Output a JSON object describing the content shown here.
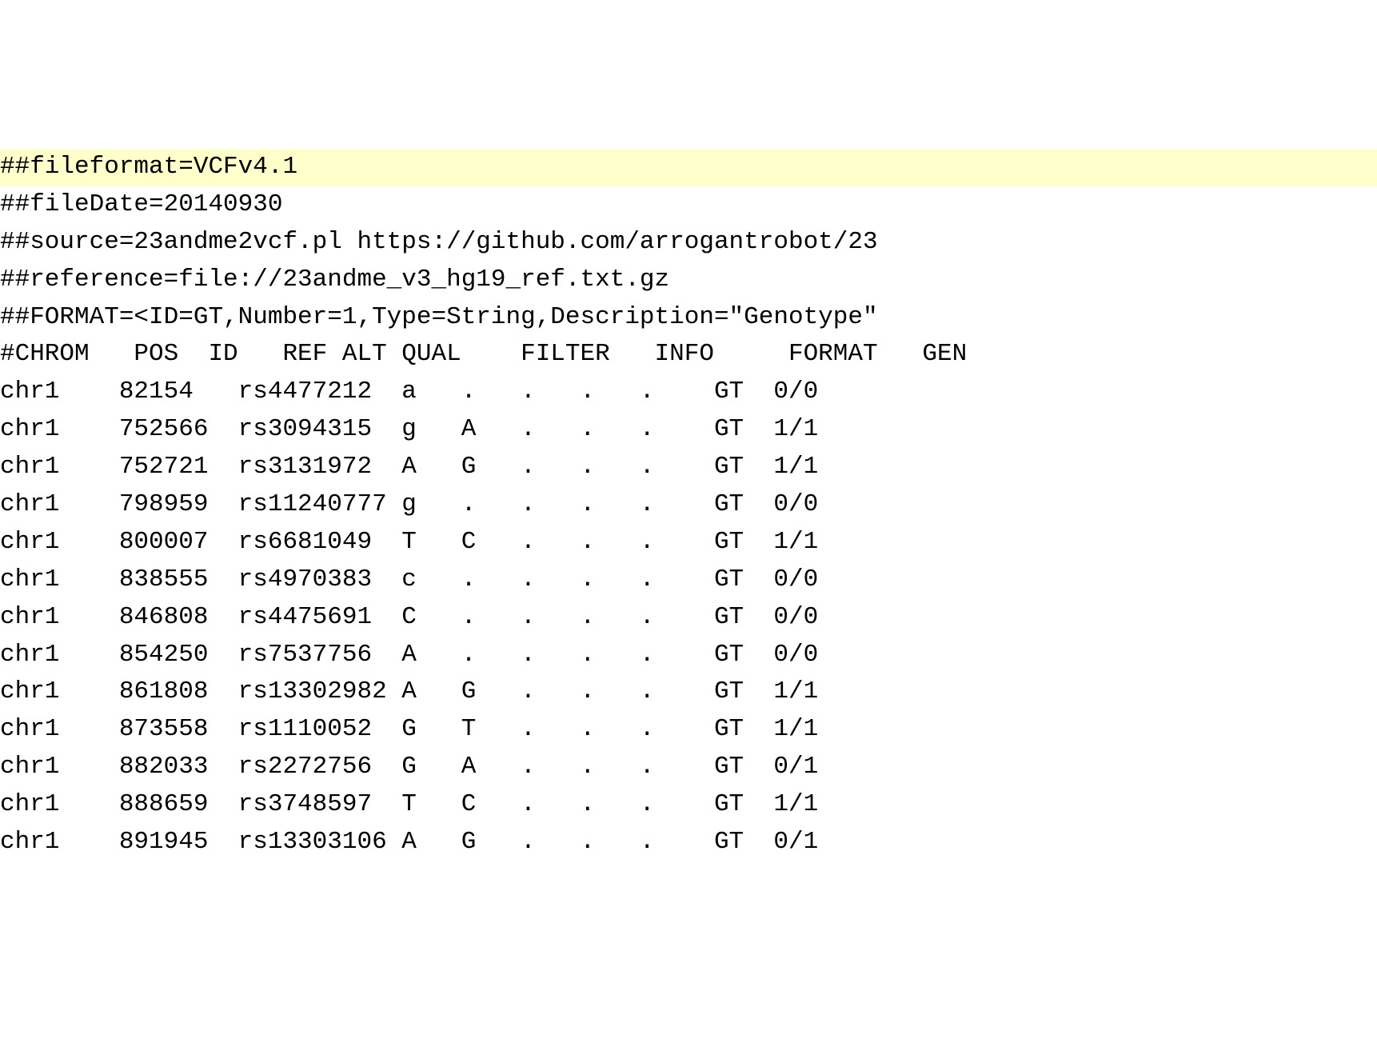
{
  "header": {
    "fileformat": "##fileformat=VCFv4.1",
    "fileDate": "##fileDate=20140930",
    "source": "##source=23andme2vcf.pl https://github.com/arrogantrobot/23",
    "reference": "##reference=file://23andme_v3_hg19_ref.txt.gz",
    "format": "##FORMAT=<ID=GT,Number=1,Type=String,Description=\"Genotype\""
  },
  "columns_line": "#CHROM   POS  ID   REF ALT QUAL    FILTER   INFO     FORMAT   GEN",
  "columns": [
    "CHROM",
    "POS",
    "ID",
    "REF",
    "ALT",
    "QUAL",
    "FILTER",
    "INFO",
    "FORMAT",
    "GEN"
  ],
  "rows": [
    {
      "chrom": "chr1",
      "pos": "82154",
      "id": "rs4477212",
      "ref": "a",
      "alt": ".",
      "qual": ".",
      "filter": ".",
      "info": ".",
      "format": "GT",
      "genotype": "0/0"
    },
    {
      "chrom": "chr1",
      "pos": "752566",
      "id": "rs3094315",
      "ref": "g",
      "alt": "A",
      "qual": ".",
      "filter": ".",
      "info": ".",
      "format": "GT",
      "genotype": "1/1"
    },
    {
      "chrom": "chr1",
      "pos": "752721",
      "id": "rs3131972",
      "ref": "A",
      "alt": "G",
      "qual": ".",
      "filter": ".",
      "info": ".",
      "format": "GT",
      "genotype": "1/1"
    },
    {
      "chrom": "chr1",
      "pos": "798959",
      "id": "rs11240777",
      "ref": "g",
      "alt": ".",
      "qual": ".",
      "filter": ".",
      "info": ".",
      "format": "GT",
      "genotype": "0/0"
    },
    {
      "chrom": "chr1",
      "pos": "800007",
      "id": "rs6681049",
      "ref": "T",
      "alt": "C",
      "qual": ".",
      "filter": ".",
      "info": ".",
      "format": "GT",
      "genotype": "1/1"
    },
    {
      "chrom": "chr1",
      "pos": "838555",
      "id": "rs4970383",
      "ref": "c",
      "alt": ".",
      "qual": ".",
      "filter": ".",
      "info": ".",
      "format": "GT",
      "genotype": "0/0"
    },
    {
      "chrom": "chr1",
      "pos": "846808",
      "id": "rs4475691",
      "ref": "C",
      "alt": ".",
      "qual": ".",
      "filter": ".",
      "info": ".",
      "format": "GT",
      "genotype": "0/0"
    },
    {
      "chrom": "chr1",
      "pos": "854250",
      "id": "rs7537756",
      "ref": "A",
      "alt": ".",
      "qual": ".",
      "filter": ".",
      "info": ".",
      "format": "GT",
      "genotype": "0/0"
    },
    {
      "chrom": "chr1",
      "pos": "861808",
      "id": "rs13302982",
      "ref": "A",
      "alt": "G",
      "qual": ".",
      "filter": ".",
      "info": ".",
      "format": "GT",
      "genotype": "1/1"
    },
    {
      "chrom": "chr1",
      "pos": "873558",
      "id": "rs1110052",
      "ref": "G",
      "alt": "T",
      "qual": ".",
      "filter": ".",
      "info": ".",
      "format": "GT",
      "genotype": "1/1"
    },
    {
      "chrom": "chr1",
      "pos": "882033",
      "id": "rs2272756",
      "ref": "G",
      "alt": "A",
      "qual": ".",
      "filter": ".",
      "info": ".",
      "format": "GT",
      "genotype": "0/1"
    },
    {
      "chrom": "chr1",
      "pos": "888659",
      "id": "rs3748597",
      "ref": "T",
      "alt": "C",
      "qual": ".",
      "filter": ".",
      "info": ".",
      "format": "GT",
      "genotype": "1/1"
    },
    {
      "chrom": "chr1",
      "pos": "891945",
      "id": "rs13303106",
      "ref": "A",
      "alt": "G",
      "qual": ".",
      "filter": ".",
      "info": ".",
      "format": "GT",
      "genotype": "0/1"
    }
  ]
}
